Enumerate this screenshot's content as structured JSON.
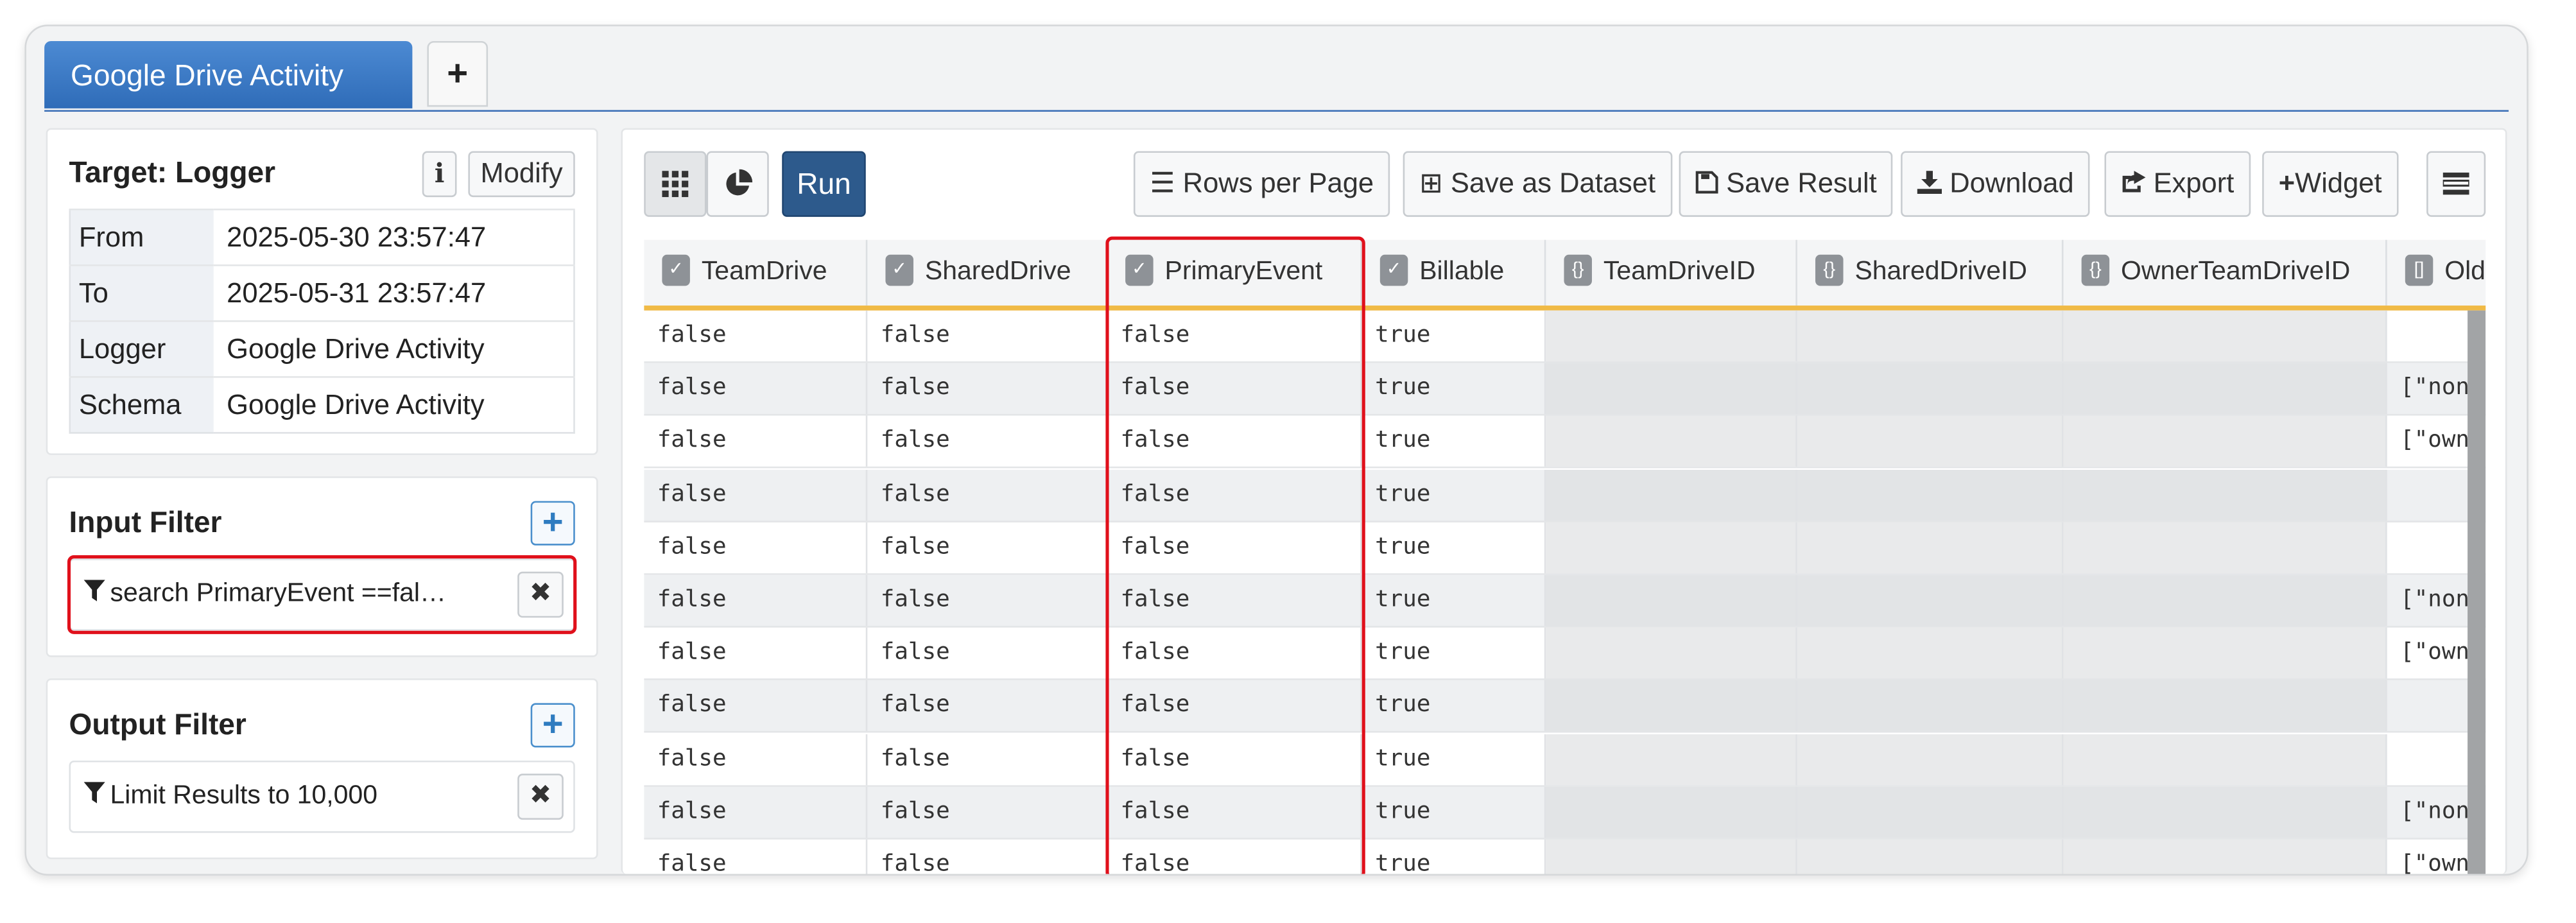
{
  "tabs": {
    "active": "Google Drive Activity",
    "add": "+"
  },
  "target": {
    "title": "Target: Logger",
    "info_label": "i",
    "modify_label": "Modify",
    "rows": [
      {
        "key": "From",
        "value": "2025-05-30 23:57:47"
      },
      {
        "key": "To",
        "value": "2025-05-31 23:57:47"
      },
      {
        "key": "Logger",
        "value": "Google Drive Activity"
      },
      {
        "key": "Schema",
        "value": "Google Drive Activity"
      }
    ]
  },
  "input_filter": {
    "title": "Input Filter",
    "add": "+",
    "item": "search PrimaryEvent ==fal…",
    "remove": "✖"
  },
  "output_filter": {
    "title": "Output Filter",
    "add": "+",
    "item": "Limit Results to 10,000",
    "remove": "✖"
  },
  "toolbar": {
    "run": "Run",
    "rows_per_page": "Rows per Page",
    "save_dataset": "Save as Dataset",
    "save_result": "Save Result",
    "download": "Download",
    "export": "Export",
    "widget": "Widget"
  },
  "grid": {
    "columns": [
      {
        "name": "TeamDrive",
        "type": "✓"
      },
      {
        "name": "SharedDrive",
        "type": "✓"
      },
      {
        "name": "PrimaryEvent",
        "type": "✓"
      },
      {
        "name": "Billable",
        "type": "✓"
      },
      {
        "name": "TeamDriveID",
        "type": "{}"
      },
      {
        "name": "SharedDriveID",
        "type": "{}"
      },
      {
        "name": "OwnerTeamDriveID",
        "type": "{}"
      },
      {
        "name": "Old",
        "type": "[]"
      }
    ],
    "rows": [
      [
        "false",
        "false",
        "false",
        "true",
        "",
        "",
        "",
        ""
      ],
      [
        "false",
        "false",
        "false",
        "true",
        "",
        "",
        "",
        "[\"non"
      ],
      [
        "false",
        "false",
        "false",
        "true",
        "",
        "",
        "",
        "[\"own"
      ],
      [
        "false",
        "false",
        "false",
        "true",
        "",
        "",
        "",
        ""
      ],
      [
        "false",
        "false",
        "false",
        "true",
        "",
        "",
        "",
        ""
      ],
      [
        "false",
        "false",
        "false",
        "true",
        "",
        "",
        "",
        "[\"non"
      ],
      [
        "false",
        "false",
        "false",
        "true",
        "",
        "",
        "",
        "[\"own"
      ],
      [
        "false",
        "false",
        "false",
        "true",
        "",
        "",
        "",
        ""
      ],
      [
        "false",
        "false",
        "false",
        "true",
        "",
        "",
        "",
        ""
      ],
      [
        "false",
        "false",
        "false",
        "true",
        "",
        "",
        "",
        "[\"non"
      ],
      [
        "false",
        "false",
        "false",
        "true",
        "",
        "",
        "",
        "[\"own"
      ]
    ]
  }
}
